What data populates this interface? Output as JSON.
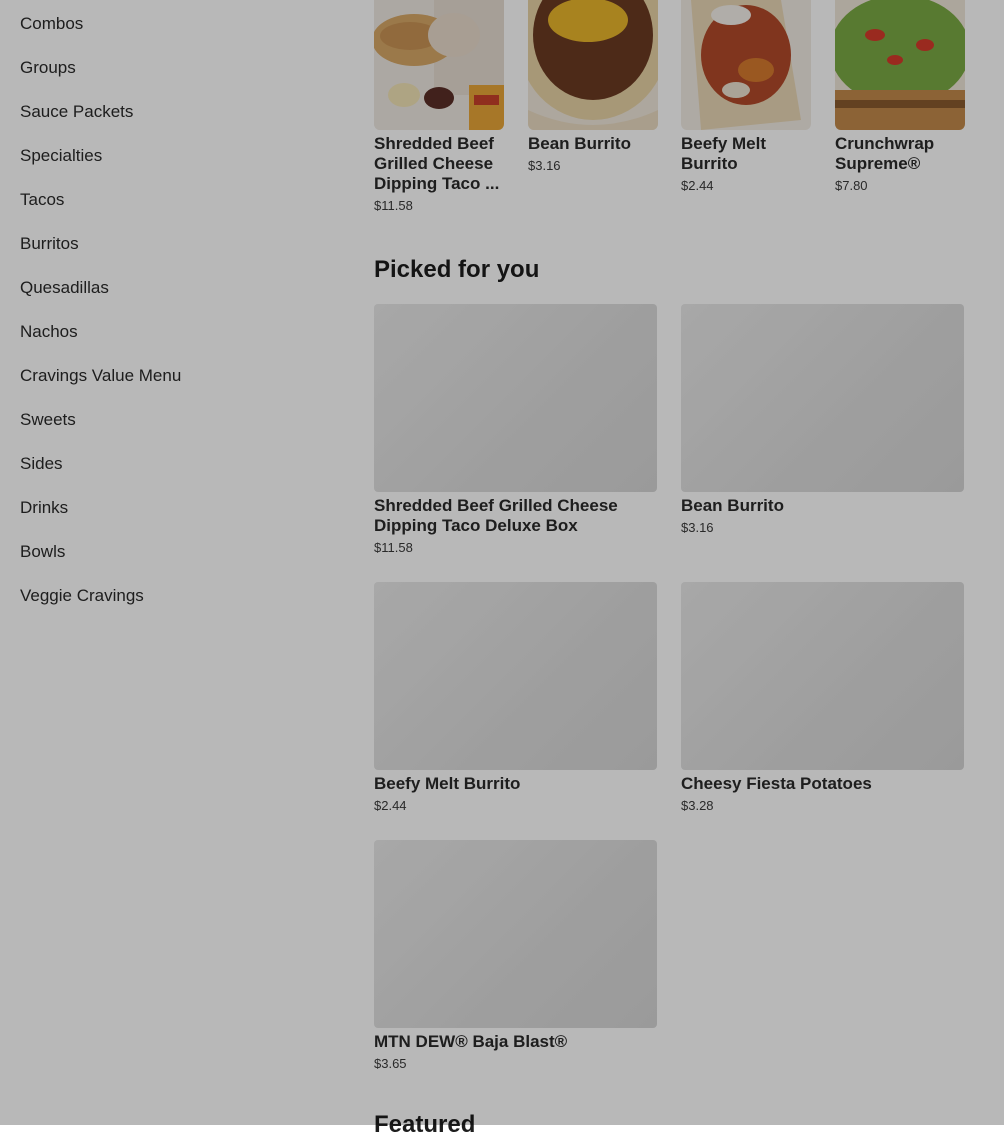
{
  "sidebar": {
    "items": [
      {
        "label": "Combos"
      },
      {
        "label": "Groups"
      },
      {
        "label": "Sauce Packets"
      },
      {
        "label": "Specialties"
      },
      {
        "label": "Tacos"
      },
      {
        "label": "Burritos"
      },
      {
        "label": "Quesadillas"
      },
      {
        "label": "Nachos"
      },
      {
        "label": "Cravings Value Menu"
      },
      {
        "label": "Sweets"
      },
      {
        "label": "Sides"
      },
      {
        "label": "Drinks"
      },
      {
        "label": "Bowls"
      },
      {
        "label": "Veggie Cravings"
      }
    ]
  },
  "top_items": [
    {
      "name": "Shredded Beef Grilled Cheese Dipping Taco ...",
      "price": "$11.58",
      "image": "taco-box-photo"
    },
    {
      "name": "Bean Burrito",
      "price": "$3.16",
      "image": "bean-burrito-photo"
    },
    {
      "name": "Beefy Melt Burrito",
      "price": "$2.44",
      "image": "beefy-melt-photo"
    },
    {
      "name": "Crunchwrap Supreme®",
      "price": "$7.80",
      "image": "crunchwrap-photo"
    }
  ],
  "picked": {
    "title": "Picked for you",
    "items": [
      {
        "name": "Shredded Beef Grilled Cheese Dipping Taco Deluxe Box",
        "price": "$11.58"
      },
      {
        "name": "Bean Burrito",
        "price": "$3.16"
      },
      {
        "name": "Beefy Melt Burrito",
        "price": "$2.44"
      },
      {
        "name": "Cheesy Fiesta Potatoes",
        "price": "$3.28"
      },
      {
        "name": "MTN DEW® Baja Blast®",
        "price": "$3.65"
      }
    ]
  },
  "next_section": {
    "title": "Featured"
  },
  "colors": {
    "overlay": "#00000047",
    "placeholder": "#dcdcdc"
  }
}
